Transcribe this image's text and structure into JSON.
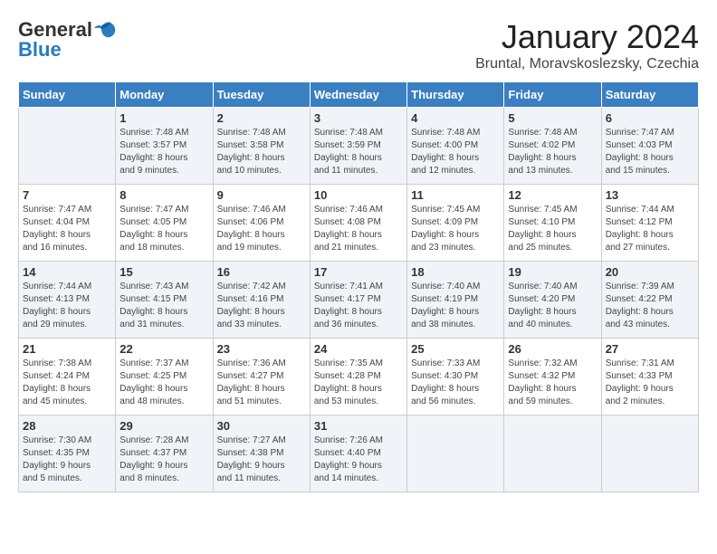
{
  "header": {
    "logo_general": "General",
    "logo_blue": "Blue",
    "month_title": "January 2024",
    "location": "Bruntal, Moravskoslezsky, Czechia"
  },
  "days_of_week": [
    "Sunday",
    "Monday",
    "Tuesday",
    "Wednesday",
    "Thursday",
    "Friday",
    "Saturday"
  ],
  "weeks": [
    [
      {
        "day": "",
        "info": ""
      },
      {
        "day": "1",
        "info": "Sunrise: 7:48 AM\nSunset: 3:57 PM\nDaylight: 8 hours\nand 9 minutes."
      },
      {
        "day": "2",
        "info": "Sunrise: 7:48 AM\nSunset: 3:58 PM\nDaylight: 8 hours\nand 10 minutes."
      },
      {
        "day": "3",
        "info": "Sunrise: 7:48 AM\nSunset: 3:59 PM\nDaylight: 8 hours\nand 11 minutes."
      },
      {
        "day": "4",
        "info": "Sunrise: 7:48 AM\nSunset: 4:00 PM\nDaylight: 8 hours\nand 12 minutes."
      },
      {
        "day": "5",
        "info": "Sunrise: 7:48 AM\nSunset: 4:02 PM\nDaylight: 8 hours\nand 13 minutes."
      },
      {
        "day": "6",
        "info": "Sunrise: 7:47 AM\nSunset: 4:03 PM\nDaylight: 8 hours\nand 15 minutes."
      }
    ],
    [
      {
        "day": "7",
        "info": "Sunrise: 7:47 AM\nSunset: 4:04 PM\nDaylight: 8 hours\nand 16 minutes."
      },
      {
        "day": "8",
        "info": "Sunrise: 7:47 AM\nSunset: 4:05 PM\nDaylight: 8 hours\nand 18 minutes."
      },
      {
        "day": "9",
        "info": "Sunrise: 7:46 AM\nSunset: 4:06 PM\nDaylight: 8 hours\nand 19 minutes."
      },
      {
        "day": "10",
        "info": "Sunrise: 7:46 AM\nSunset: 4:08 PM\nDaylight: 8 hours\nand 21 minutes."
      },
      {
        "day": "11",
        "info": "Sunrise: 7:45 AM\nSunset: 4:09 PM\nDaylight: 8 hours\nand 23 minutes."
      },
      {
        "day": "12",
        "info": "Sunrise: 7:45 AM\nSunset: 4:10 PM\nDaylight: 8 hours\nand 25 minutes."
      },
      {
        "day": "13",
        "info": "Sunrise: 7:44 AM\nSunset: 4:12 PM\nDaylight: 8 hours\nand 27 minutes."
      }
    ],
    [
      {
        "day": "14",
        "info": "Sunrise: 7:44 AM\nSunset: 4:13 PM\nDaylight: 8 hours\nand 29 minutes."
      },
      {
        "day": "15",
        "info": "Sunrise: 7:43 AM\nSunset: 4:15 PM\nDaylight: 8 hours\nand 31 minutes."
      },
      {
        "day": "16",
        "info": "Sunrise: 7:42 AM\nSunset: 4:16 PM\nDaylight: 8 hours\nand 33 minutes."
      },
      {
        "day": "17",
        "info": "Sunrise: 7:41 AM\nSunset: 4:17 PM\nDaylight: 8 hours\nand 36 minutes."
      },
      {
        "day": "18",
        "info": "Sunrise: 7:40 AM\nSunset: 4:19 PM\nDaylight: 8 hours\nand 38 minutes."
      },
      {
        "day": "19",
        "info": "Sunrise: 7:40 AM\nSunset: 4:20 PM\nDaylight: 8 hours\nand 40 minutes."
      },
      {
        "day": "20",
        "info": "Sunrise: 7:39 AM\nSunset: 4:22 PM\nDaylight: 8 hours\nand 43 minutes."
      }
    ],
    [
      {
        "day": "21",
        "info": "Sunrise: 7:38 AM\nSunset: 4:24 PM\nDaylight: 8 hours\nand 45 minutes."
      },
      {
        "day": "22",
        "info": "Sunrise: 7:37 AM\nSunset: 4:25 PM\nDaylight: 8 hours\nand 48 minutes."
      },
      {
        "day": "23",
        "info": "Sunrise: 7:36 AM\nSunset: 4:27 PM\nDaylight: 8 hours\nand 51 minutes."
      },
      {
        "day": "24",
        "info": "Sunrise: 7:35 AM\nSunset: 4:28 PM\nDaylight: 8 hours\nand 53 minutes."
      },
      {
        "day": "25",
        "info": "Sunrise: 7:33 AM\nSunset: 4:30 PM\nDaylight: 8 hours\nand 56 minutes."
      },
      {
        "day": "26",
        "info": "Sunrise: 7:32 AM\nSunset: 4:32 PM\nDaylight: 8 hours\nand 59 minutes."
      },
      {
        "day": "27",
        "info": "Sunrise: 7:31 AM\nSunset: 4:33 PM\nDaylight: 9 hours\nand 2 minutes."
      }
    ],
    [
      {
        "day": "28",
        "info": "Sunrise: 7:30 AM\nSunset: 4:35 PM\nDaylight: 9 hours\nand 5 minutes."
      },
      {
        "day": "29",
        "info": "Sunrise: 7:28 AM\nSunset: 4:37 PM\nDaylight: 9 hours\nand 8 minutes."
      },
      {
        "day": "30",
        "info": "Sunrise: 7:27 AM\nSunset: 4:38 PM\nDaylight: 9 hours\nand 11 minutes."
      },
      {
        "day": "31",
        "info": "Sunrise: 7:26 AM\nSunset: 4:40 PM\nDaylight: 9 hours\nand 14 minutes."
      },
      {
        "day": "",
        "info": ""
      },
      {
        "day": "",
        "info": ""
      },
      {
        "day": "",
        "info": ""
      }
    ]
  ]
}
